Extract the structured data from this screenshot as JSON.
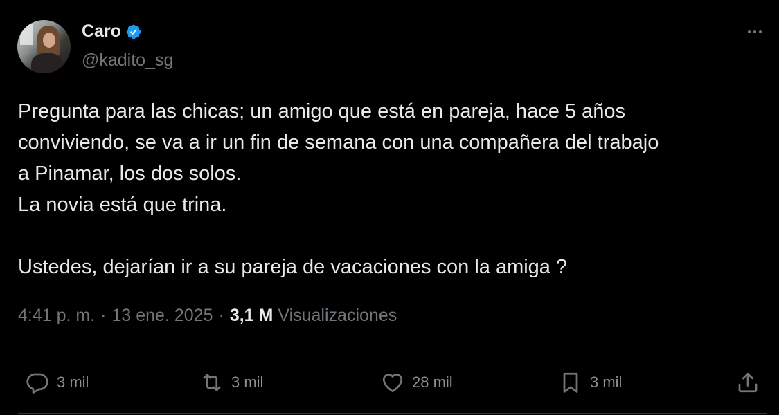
{
  "author": {
    "display_name": "Caro",
    "handle": "@kadito_sg",
    "verified_icon": "verified-badge-icon",
    "verified_color": "#1d9bf0"
  },
  "tweet": {
    "lines": [
      "Pregunta para las chicas; un amigo que está en pareja, hace 5 años",
      "conviviendo, se va a ir un fin de semana con una compañera del trabajo",
      "a Pinamar, los dos solos.",
      "La novia está que trina.",
      "",
      "Ustedes, dejarían ir a su pareja de vacaciones con la amiga ?"
    ]
  },
  "meta": {
    "time": "4:41 p. m.",
    "separator": "·",
    "date": "13 ene. 2025",
    "views_count": "3,1 M",
    "views_label": "Visualizaciones"
  },
  "actions": {
    "reply": {
      "icon": "reply-icon",
      "count": "3 mil"
    },
    "repost": {
      "icon": "repost-icon",
      "count": "3 mil"
    },
    "like": {
      "icon": "heart-icon",
      "count": "28 mil"
    },
    "bookmark": {
      "icon": "bookmark-icon",
      "count": "3 mil"
    },
    "share": {
      "icon": "share-icon"
    }
  },
  "colors": {
    "background": "#000000",
    "text_primary": "#e7e9ea",
    "text_secondary": "#71767b",
    "divider": "#2f3336"
  }
}
